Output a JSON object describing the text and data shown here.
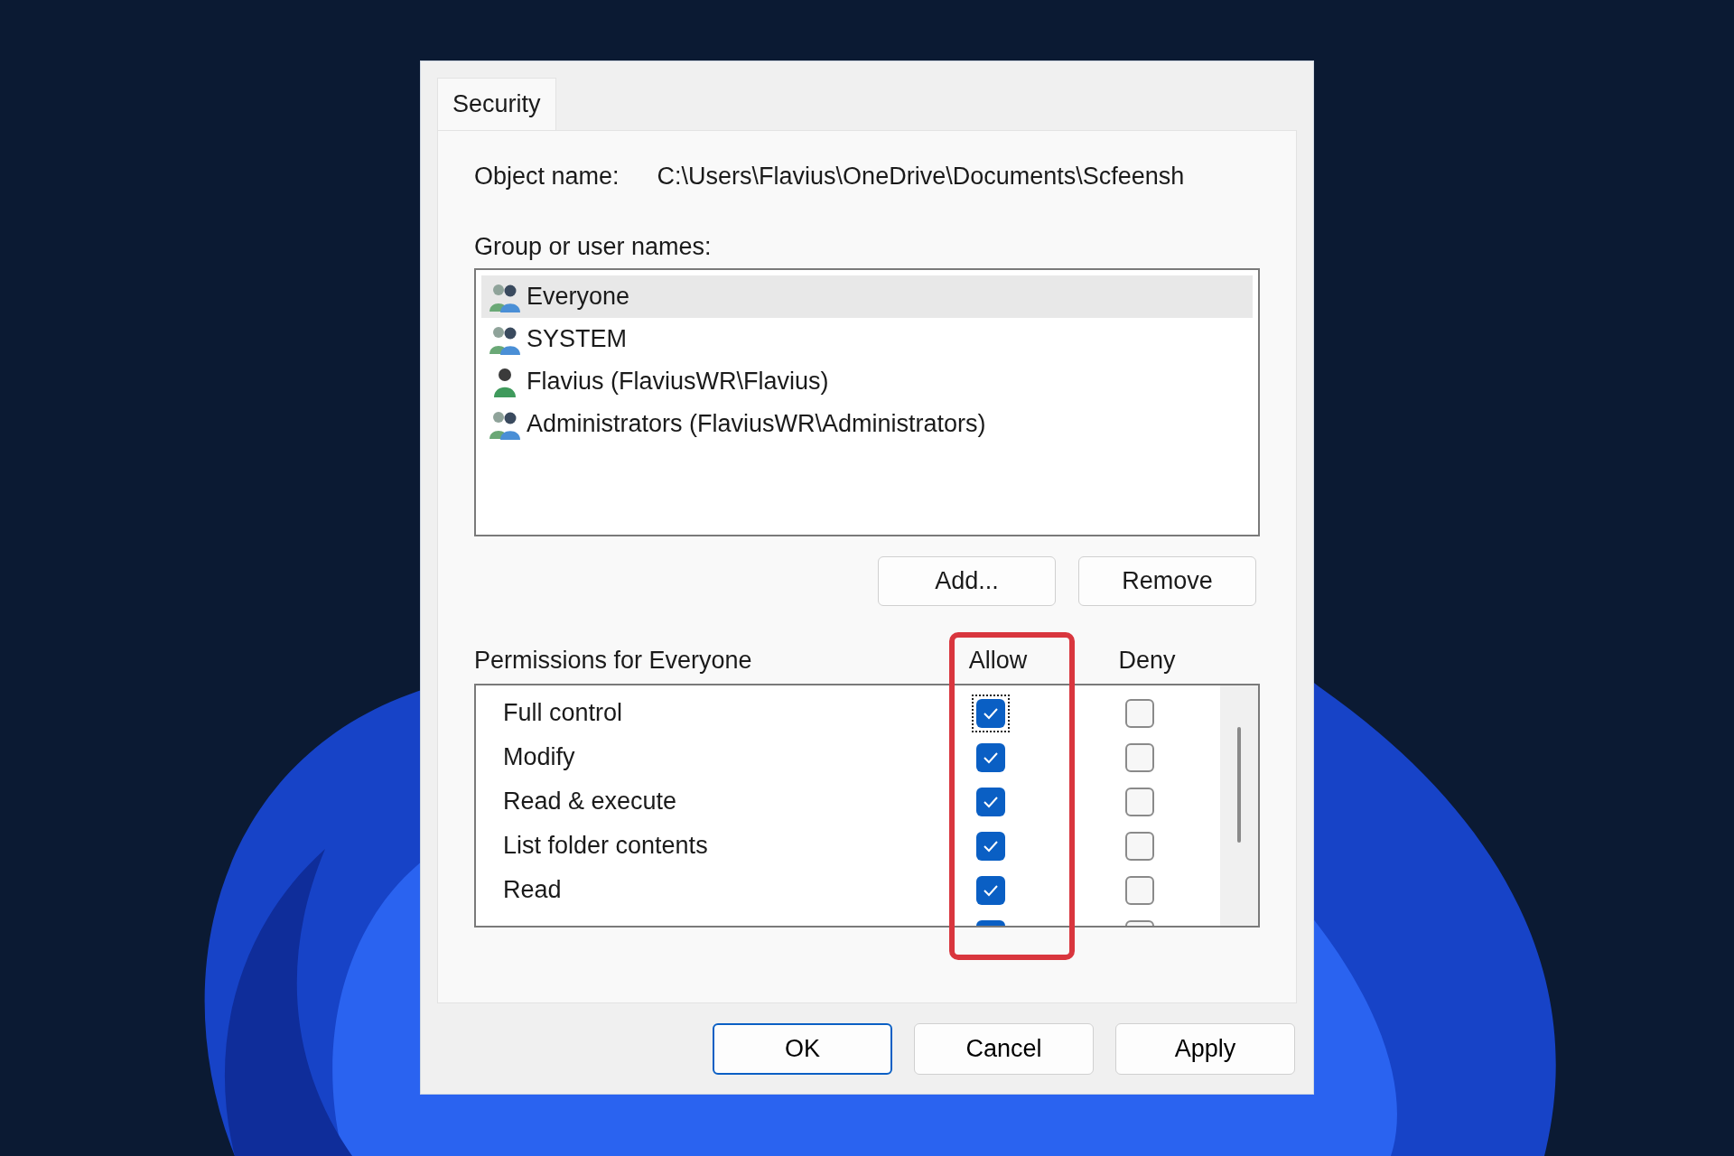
{
  "tabs": [
    {
      "label": "Security",
      "selected": true
    }
  ],
  "object_name": {
    "label": "Object name:",
    "value": "C:\\Users\\Flavius\\OneDrive\\Documents\\Scfeensh"
  },
  "group_list": {
    "label": "Group or user names:",
    "items": [
      {
        "name": "Everyone",
        "kind": "group",
        "selected": true
      },
      {
        "name": "SYSTEM",
        "kind": "group",
        "selected": false
      },
      {
        "name": "Flavius (FlaviusWR\\Flavius)",
        "kind": "user",
        "selected": false
      },
      {
        "name": "Administrators (FlaviusWR\\Administrators)",
        "kind": "group",
        "selected": false
      }
    ]
  },
  "list_buttons": [
    "Add...",
    "Remove"
  ],
  "permissions": {
    "label": "Permissions for Everyone",
    "columns": [
      "Allow",
      "Deny"
    ],
    "rows": [
      {
        "name": "Full control",
        "allow": true,
        "deny": false,
        "focused": true
      },
      {
        "name": "Modify",
        "allow": true,
        "deny": false,
        "focused": false
      },
      {
        "name": "Read & execute",
        "allow": true,
        "deny": false,
        "focused": false
      },
      {
        "name": "List folder contents",
        "allow": true,
        "deny": false,
        "focused": false
      },
      {
        "name": "Read",
        "allow": true,
        "deny": false,
        "focused": false
      },
      {
        "allow": true,
        "deny": false,
        "focused": false
      }
    ]
  },
  "dialog_buttons": [
    {
      "label": "OK",
      "default": true
    },
    {
      "label": "Cancel",
      "default": false
    },
    {
      "label": "Apply",
      "default": false
    }
  ]
}
